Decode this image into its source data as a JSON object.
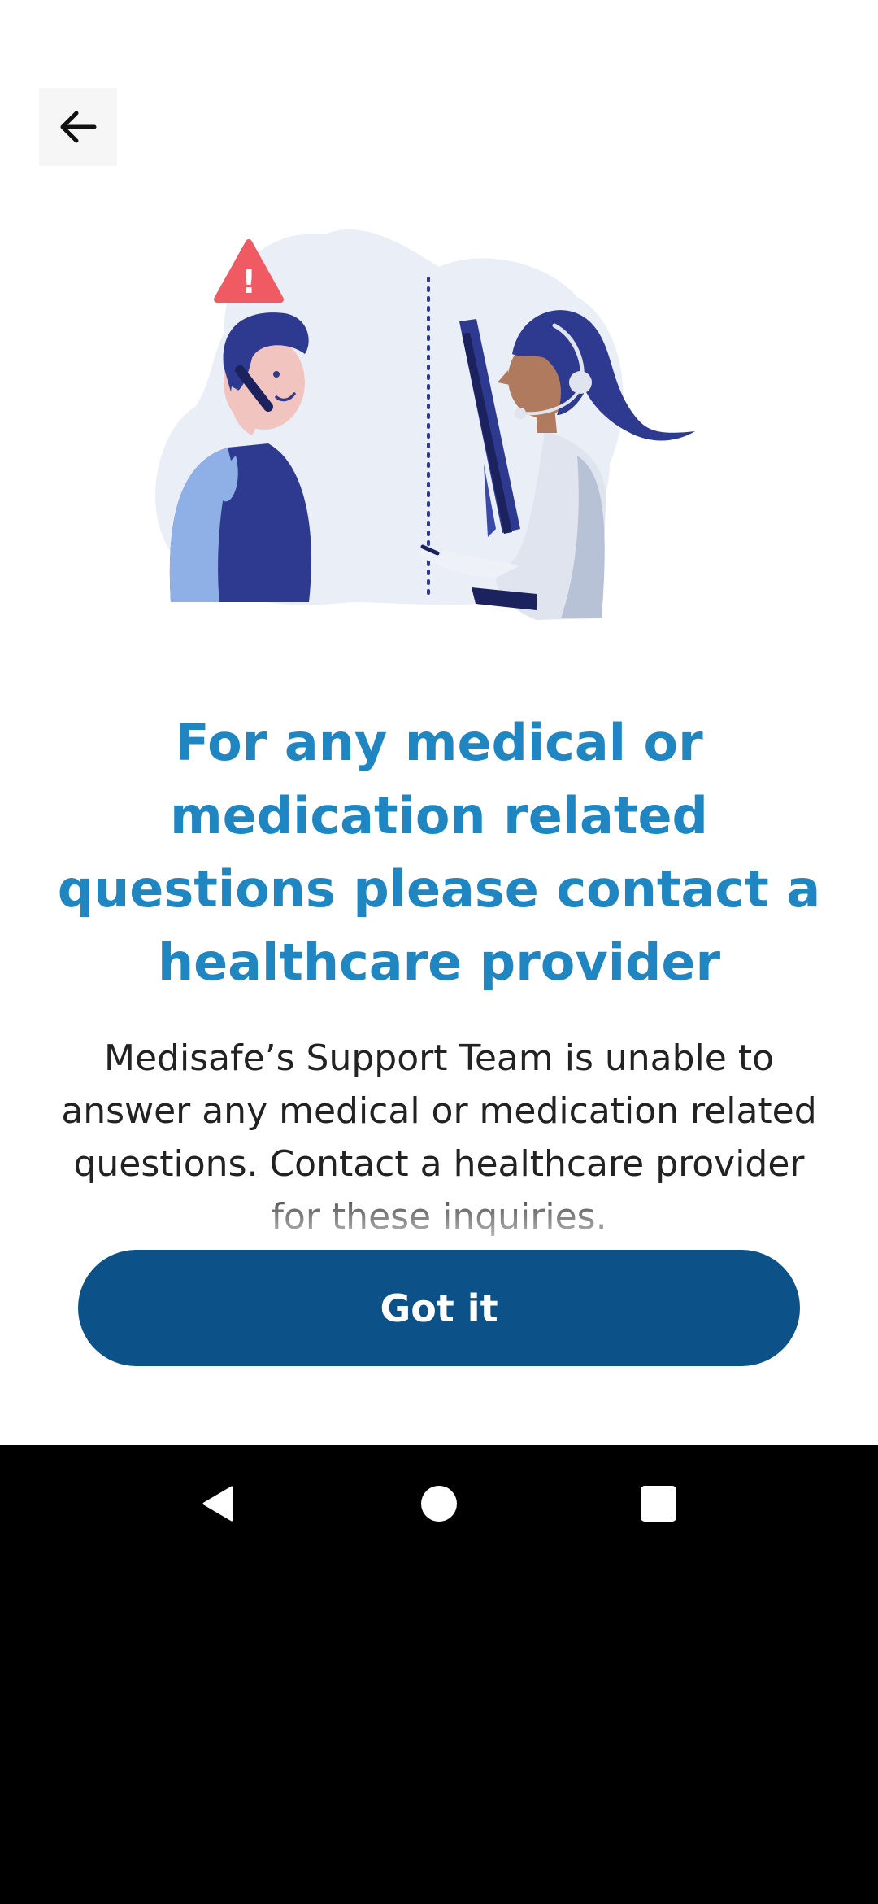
{
  "header": {
    "back_icon": "arrow-left-icon"
  },
  "illustration": {
    "icons": [
      "warning-icon",
      "patient-on-phone",
      "support-agent-with-headset",
      "computer-monitor"
    ],
    "warning_mark": "!",
    "colors": {
      "blob": "#e9eef7",
      "navy": "#2e3a8f",
      "light_blue": "#8fb0e6",
      "warning": "#f05a63"
    }
  },
  "main": {
    "headline": "For any medical or medication related questions please contact a healthcare provider",
    "body": "Medisafe’s Support Team is unable to answer any medical or medication related questions. Contact a healthcare provider for these inquiries.",
    "button_label": "Got it"
  },
  "nav": {
    "back_icon": "triangle-back-icon",
    "home_icon": "circle-home-icon",
    "recents_icon": "square-recents-icon"
  },
  "colors": {
    "headline": "#1f86c2",
    "button": "#0c5289",
    "body_text": "#222222",
    "background": "#ffffff",
    "nav_bar": "#000000"
  }
}
